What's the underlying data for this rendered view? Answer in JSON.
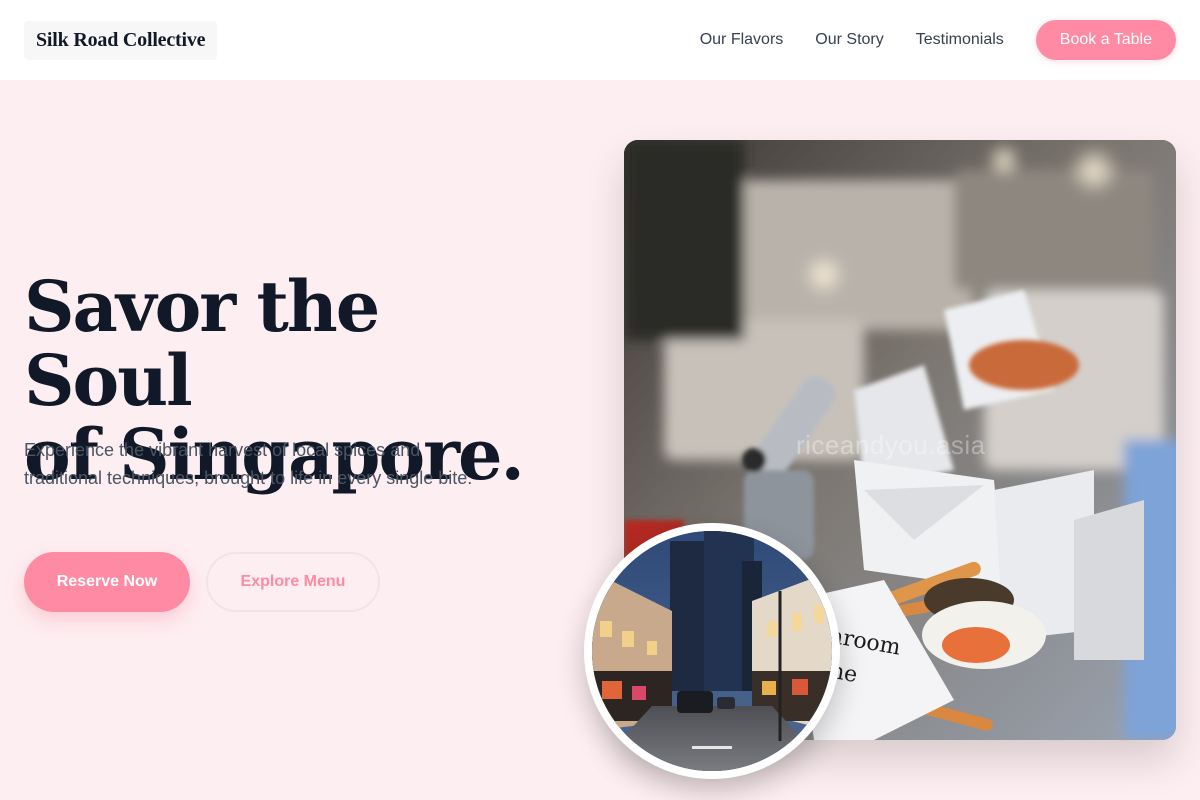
{
  "header": {
    "brand": "Silk Road Collective",
    "nav": [
      "Our Flavors",
      "Our Story",
      "Testimonials"
    ],
    "cta_label": "Book a Table"
  },
  "hero": {
    "title_line1": "Savor the Soul",
    "title_line2": "of Singapore.",
    "subtitle": "Experience the vibrant harvest of local spices and traditional techniques, brought to life in every single bite.",
    "primary_label": "Reserve Now",
    "secondary_label": "Explore Menu"
  },
  "images": {
    "food_watermark": "riceandyou.asia",
    "food_box_text_1": "aroom",
    "food_box_text_2": "ne"
  },
  "colors": {
    "accent": "#ff8aa3",
    "background": "#fdeef1",
    "header": "#ffffff",
    "heading": "#111827"
  }
}
